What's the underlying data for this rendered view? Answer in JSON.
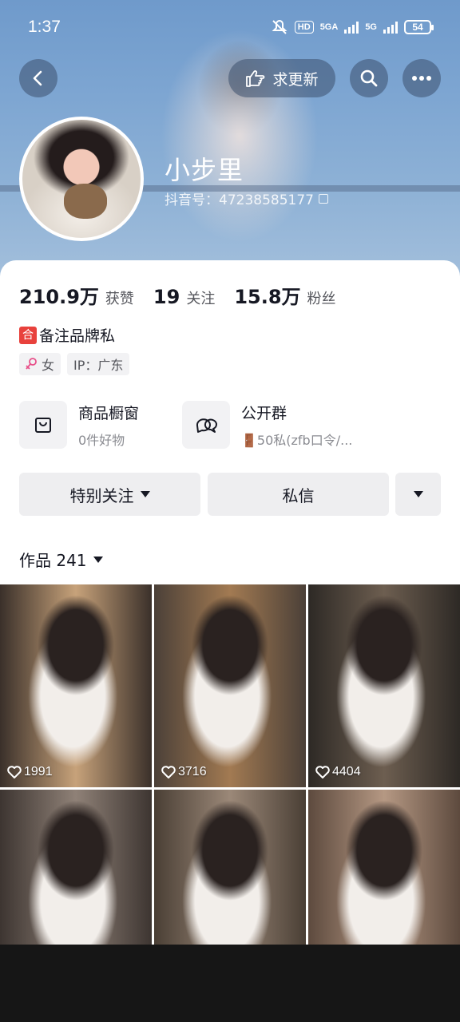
{
  "status": {
    "time": "1:37",
    "hd": "HD",
    "net1": "5GA",
    "net2": "5G",
    "battery": "54"
  },
  "header": {
    "request_update_label": "求更新"
  },
  "profile": {
    "nickname": "小步里",
    "douyin_id": "抖音号：47238585177"
  },
  "stats": [
    {
      "num": "210.9万",
      "label": "获赞"
    },
    {
      "num": "19",
      "label": "关注"
    },
    {
      "num": "15.8万",
      "label": "粉丝"
    }
  ],
  "bio": {
    "badge": "合",
    "text": "备注品牌私"
  },
  "tags": {
    "gender": "女",
    "ip": "IP：广东"
  },
  "features": {
    "shop": {
      "title": "商品橱窗",
      "sub": "0件好物"
    },
    "group": {
      "title": "公开群",
      "sub": "🚪50私(zfb口令/..."
    }
  },
  "actions": {
    "follow": "特别关注",
    "message": "私信"
  },
  "works": {
    "label": "作品 241"
  },
  "grid_items": [
    {
      "likes": "1991",
      "colors": [
        "#3a302a",
        "#c7a27a"
      ]
    },
    {
      "likes": "3716",
      "colors": [
        "#4b4038",
        "#a27a52"
      ]
    },
    {
      "likes": "4404",
      "colors": [
        "#2d2925",
        "#6d5e50"
      ]
    },
    {
      "likes": "",
      "colors": [
        "#3d3531",
        "#8f8177"
      ]
    },
    {
      "likes": "",
      "colors": [
        "#4a3f35",
        "#9b8878"
      ]
    },
    {
      "likes": "",
      "colors": [
        "#5d4a3e",
        "#b59883"
      ]
    }
  ],
  "accent": "#fe2c55"
}
